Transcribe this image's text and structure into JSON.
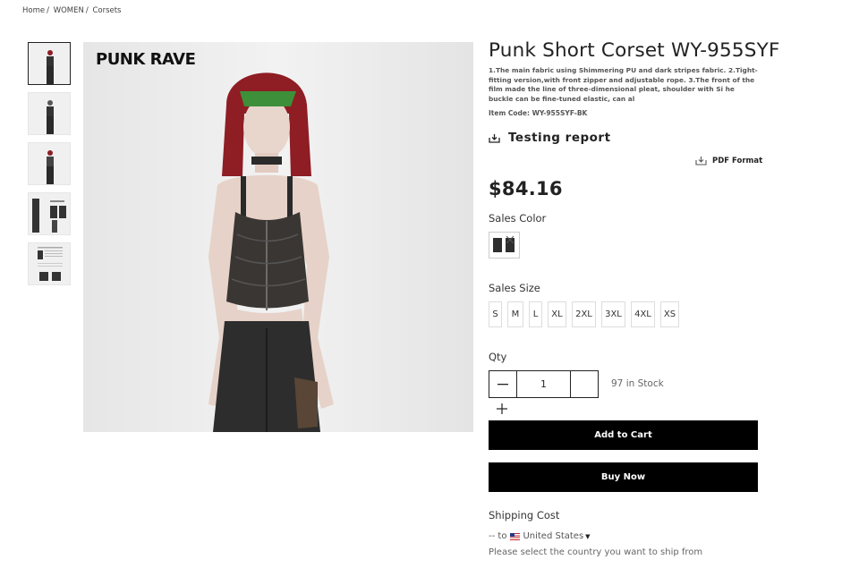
{
  "breadcrumb": [
    "Home",
    "WOMEN",
    "Corsets"
  ],
  "breadcrumb_sep": "/",
  "product": {
    "brand_logo": "PUNK RAVE",
    "title": "Punk Short Corset WY-955SYF",
    "description": "1.The main fabric using Shimmering PU and dark stripes fabric. 2.Tight-fitting version,with front zipper and adjustable rope. 3.The front of the film made the line of three-dimensional pleat, shoulder with Si he buckle can be fine-tuned elastic, can al",
    "item_code": "Item Code: WY-955SYF-BK",
    "price": "$84.16"
  },
  "testing_report": {
    "label": "Testing report",
    "icon": "download-tray-icon"
  },
  "pdf": {
    "label": "PDF Format",
    "icon": "download-tray-icon"
  },
  "sales_color": {
    "label": "Sales Color"
  },
  "sales_size": {
    "label": "Sales Size",
    "options": [
      "S",
      "M",
      "L",
      "XL",
      "2XL",
      "3XL",
      "4XL",
      "XS"
    ]
  },
  "qty": {
    "label": "Qty",
    "value": "1",
    "stock": "97 in Stock"
  },
  "buttons": {
    "add_to_cart": "Add to Cart",
    "buy_now": "Buy Now"
  },
  "shipping": {
    "label": "Shipping Cost",
    "prefix": "-- to",
    "country": "United States",
    "note": "Please select the country you want to ship from"
  },
  "colors": {
    "button_bg": "#000000",
    "text": "#222222",
    "hair": "#8e1d24",
    "corset": "#3a3634"
  }
}
